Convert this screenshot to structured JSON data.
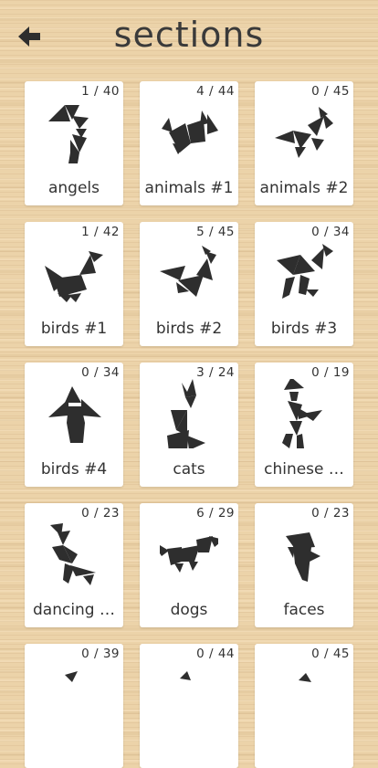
{
  "header": {
    "title": "sections",
    "back_icon": "back-arrow-icon"
  },
  "accent_color": "#333333",
  "sections": [
    {
      "label": "angels",
      "progress": "1 / 40"
    },
    {
      "label": "animals #1",
      "progress": "4 / 44"
    },
    {
      "label": "animals #2",
      "progress": "0 / 45"
    },
    {
      "label": "birds #1",
      "progress": "1 / 42"
    },
    {
      "label": "birds #2",
      "progress": "5 / 45"
    },
    {
      "label": "birds #3",
      "progress": "0 / 34"
    },
    {
      "label": "birds #4",
      "progress": "0 / 34"
    },
    {
      "label": "cats",
      "progress": "3 / 24"
    },
    {
      "label": "chinese …",
      "progress": "0 / 19"
    },
    {
      "label": "dancing …",
      "progress": "0 / 23"
    },
    {
      "label": "dogs",
      "progress": "6 / 29"
    },
    {
      "label": "faces",
      "progress": "0 / 23"
    },
    {
      "label": "",
      "progress": "0 / 39"
    },
    {
      "label": "",
      "progress": "0 / 44"
    },
    {
      "label": "",
      "progress": "0 / 45"
    }
  ]
}
